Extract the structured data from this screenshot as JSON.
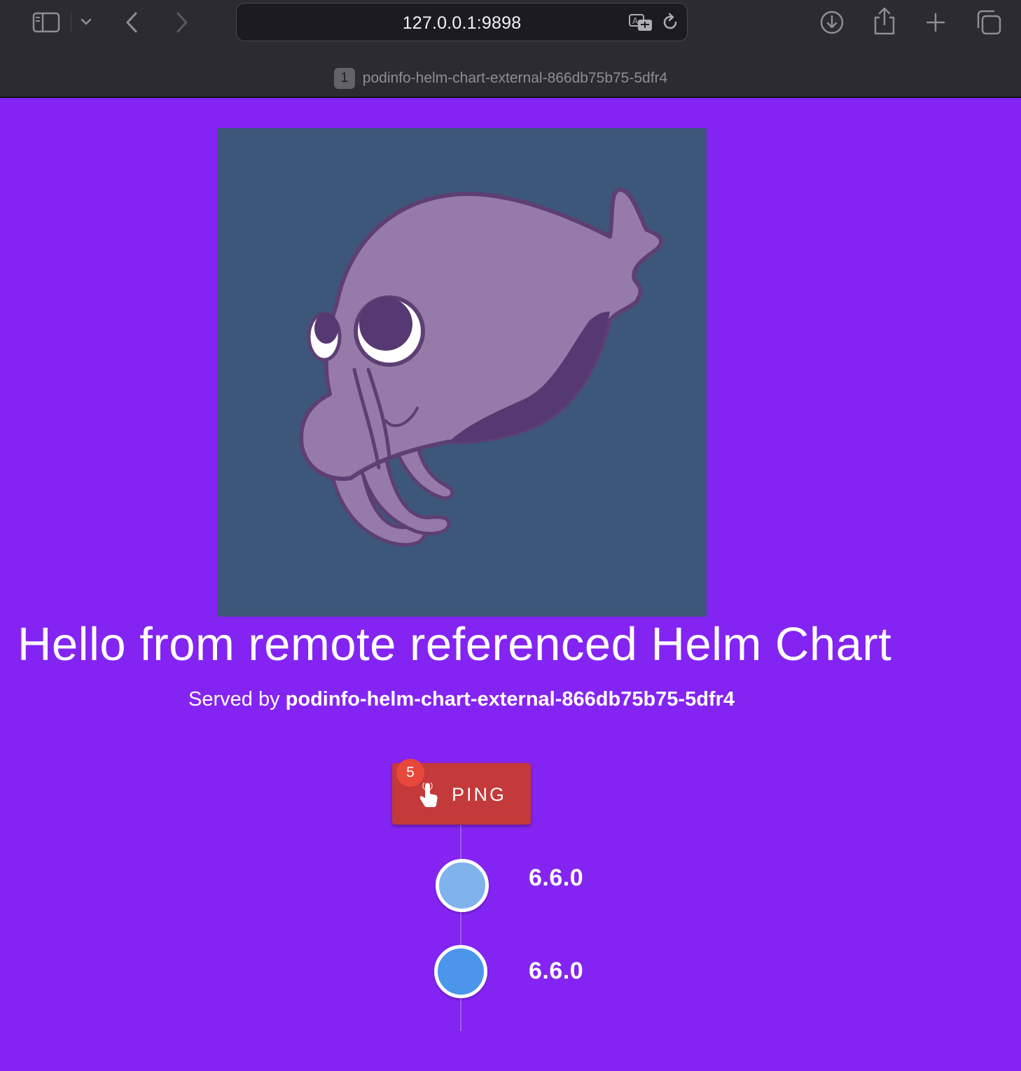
{
  "browser": {
    "address": "127.0.0.1:9898",
    "tab_count": "1",
    "tab_title": "podinfo-helm-chart-external-866db75b75-5dfr4",
    "icons": [
      "sidebar-icon",
      "chevron-down-icon",
      "back-icon",
      "forward-icon",
      "translate-icon",
      "reload-icon",
      "download-icon",
      "share-icon",
      "plus-icon",
      "tabs-icon"
    ]
  },
  "page": {
    "background_color": "#8424f2",
    "headline": "Hello from remote referenced Helm Chart",
    "served_by_prefix": "Served by",
    "served_by_host": "podinfo-helm-chart-external-866db75b75-5dfr4",
    "ping": {
      "label": "PING",
      "count": "5",
      "color": "#c4393a",
      "icon": "touch-hand-icon"
    },
    "timeline": [
      {
        "version": "6.6.0",
        "dot_color": "#80b3ec"
      },
      {
        "version": "6.6.0",
        "dot_color": "#4b96ea"
      }
    ]
  }
}
